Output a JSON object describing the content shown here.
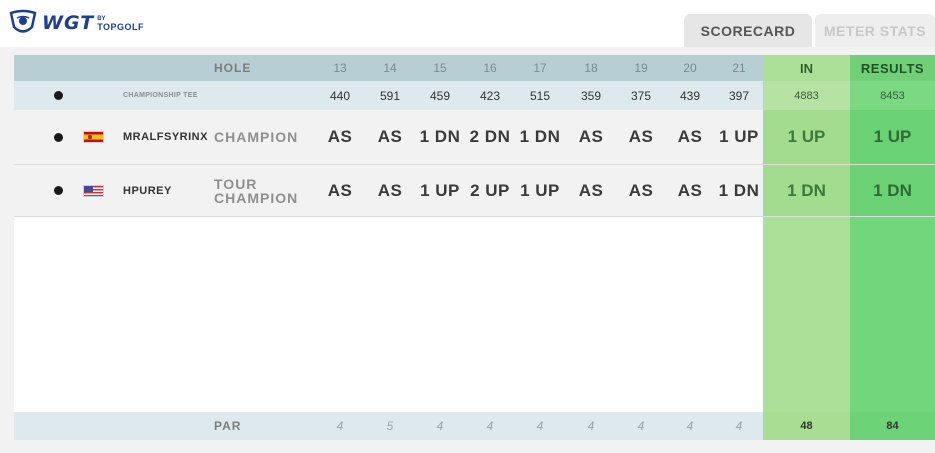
{
  "brand": {
    "logo_text": "WGT",
    "logo_by": "BY",
    "logo_sub": "TOPGOLF"
  },
  "tabs": [
    {
      "label": "SCORECARD",
      "active": true
    },
    {
      "label": "METER STATS",
      "active": false
    }
  ],
  "scorecard": {
    "hole_label": "HOLE",
    "holes": [
      "13",
      "14",
      "15",
      "16",
      "17",
      "18",
      "19",
      "20",
      "21"
    ],
    "in_label": "IN",
    "results_label": "RESULTS",
    "tee": {
      "label": "CHAMPIONSHIP TEE",
      "yards": [
        "440",
        "591",
        "459",
        "423",
        "515",
        "359",
        "375",
        "439",
        "397"
      ],
      "in": "4883",
      "results": "8453"
    },
    "players": [
      {
        "name": "MRALFSYRINX",
        "flag": "spain-flag-icon",
        "tier_line1": "CHAMPION",
        "tier_line2": "",
        "scores": [
          "AS",
          "AS",
          "1 DN",
          "2 DN",
          "1 DN",
          "AS",
          "AS",
          "AS",
          "1 UP"
        ],
        "in": "1 UP",
        "results": "1 UP"
      },
      {
        "name": "HPUREY",
        "flag": "usa-flag-icon",
        "tier_line1": "TOUR",
        "tier_line2": "CHAMPION",
        "scores": [
          "AS",
          "AS",
          "1 UP",
          "2 UP",
          "1 UP",
          "AS",
          "AS",
          "AS",
          "1 DN"
        ],
        "in": "1 DN",
        "results": "1 DN"
      }
    ],
    "par": {
      "label": "PAR",
      "values": [
        "4",
        "5",
        "4",
        "4",
        "4",
        "4",
        "4",
        "4",
        "4"
      ],
      "in": "48",
      "results": "84"
    }
  },
  "colors": {
    "header_row": "#b7ced5",
    "tee_row": "#dde9ec",
    "in_column": "#acdf98",
    "results_column": "#72d67c",
    "logo_blue": "#1d3f8f"
  }
}
